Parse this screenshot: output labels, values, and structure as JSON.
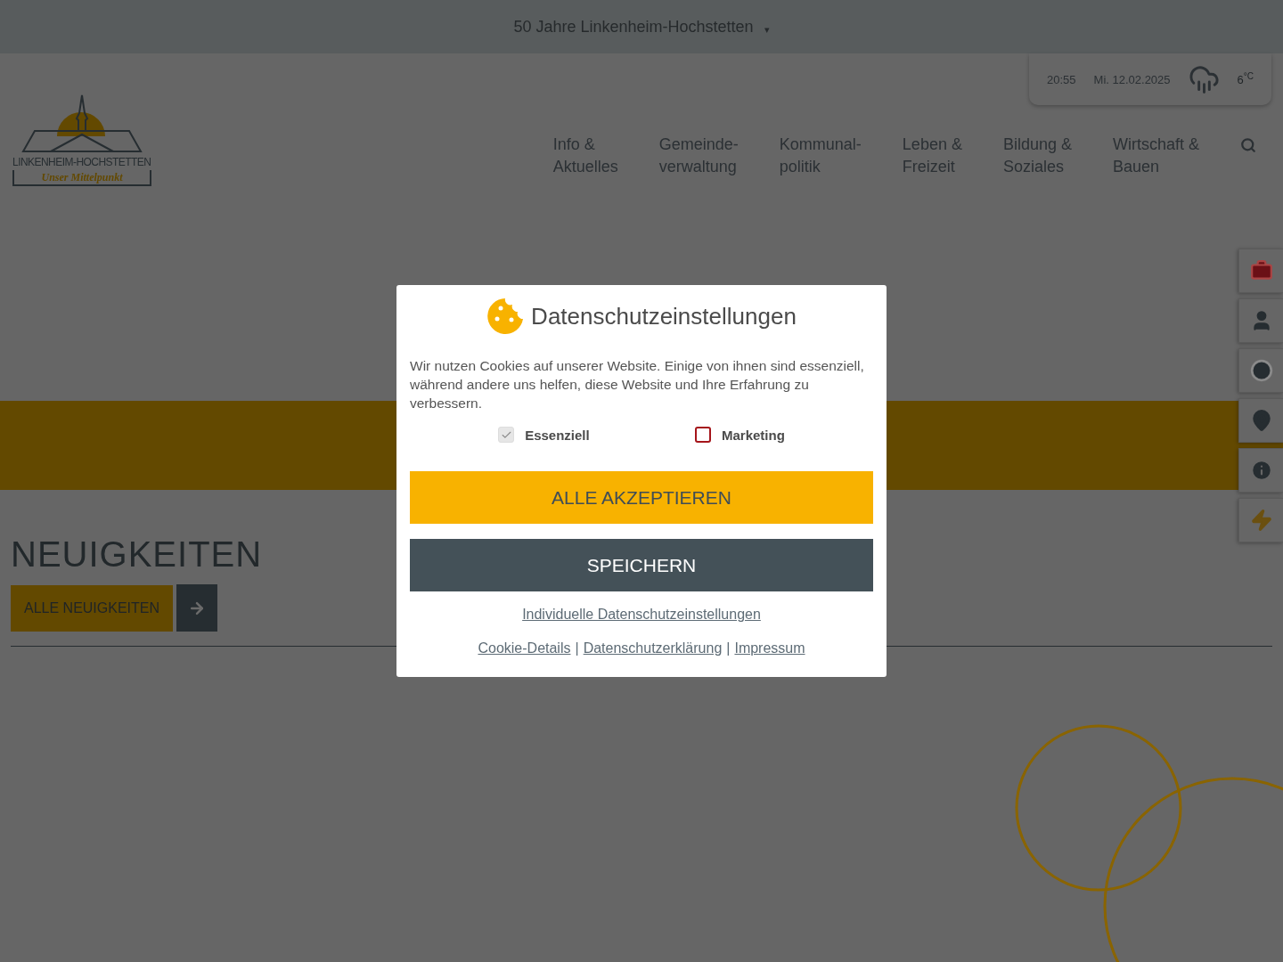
{
  "announcement": {
    "label": "50 Jahre Linkenheim-Hochstetten",
    "caret": "▾"
  },
  "weather": {
    "time": "20:55",
    "date": "Mi. 12.02.2025",
    "temperature": "6",
    "unit": "°C"
  },
  "logo": {
    "name": "LINKENHEIM-HOCHSTETTEN",
    "tagline": "Unser Mittelpunkt"
  },
  "nav": [
    {
      "lines": [
        "Info &",
        "Aktuelles"
      ]
    },
    {
      "lines": [
        "Gemeinde-",
        "verwaltung"
      ]
    },
    {
      "lines": [
        "Kommunal-",
        "politik"
      ]
    },
    {
      "lines": [
        "Leben &",
        "Freizeit"
      ]
    },
    {
      "lines": [
        "Bildung &",
        "Soziales"
      ]
    },
    {
      "lines": [
        "Wirtschaft &",
        "Bauen"
      ]
    }
  ],
  "news": {
    "title": "NEUIGKEITEN",
    "button": "ALLE NEUIGKEITEN"
  },
  "side_buttons": [
    {
      "kind": "first-aid"
    },
    {
      "kind": "person"
    },
    {
      "kind": "clock"
    },
    {
      "kind": "location"
    },
    {
      "kind": "info"
    },
    {
      "kind": "bolt"
    }
  ],
  "cookie_dialog": {
    "title": "Datenschutzeinstellungen",
    "text": "Wir nutzen Cookies auf unserer Website. Einige von ihnen sind essenziell, während andere uns helfen, diese Website und Ihre Erfahrung zu verbessern.",
    "options": [
      {
        "label": "Essenziell",
        "checked": true,
        "disabled": true
      },
      {
        "label": "Marketing",
        "checked": false,
        "disabled": false
      }
    ],
    "accept_button": "ALLE AKZEPTIEREN",
    "save_button": "SPEICHERN",
    "settings_link": "Individuelle Datenschutzeinstellungen",
    "footer_links": [
      "Cookie-Details",
      "Datenschutzerklärung",
      "Impressum"
    ],
    "separator": "|"
  }
}
